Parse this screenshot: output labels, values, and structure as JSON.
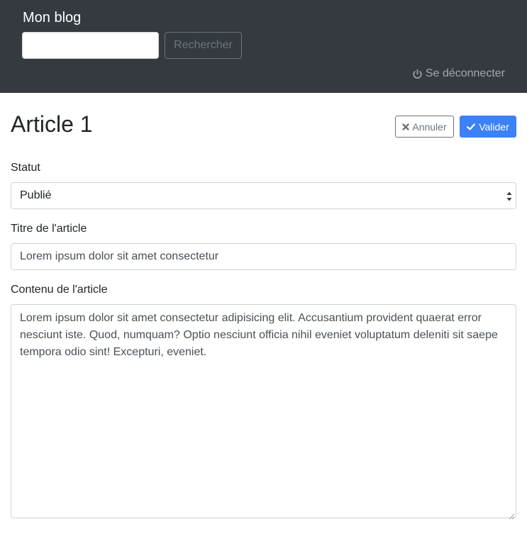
{
  "navbar": {
    "brand": "Mon blog",
    "search_value": "",
    "search_button": "Rechercher",
    "logout_label": "Se déconnecter",
    "logout_icon": "power-icon"
  },
  "header": {
    "title": "Article 1",
    "cancel_label": "Annuler",
    "cancel_icon": "times-icon",
    "validate_label": "Valider",
    "validate_icon": "check-icon"
  },
  "form": {
    "status_label": "Statut",
    "status_value": "Publié",
    "title_label": "Titre de l'article",
    "title_value": "Lorem ipsum dolor sit amet consectetur",
    "content_label": "Contenu de l'article",
    "content_value": "Lorem ipsum dolor sit amet consectetur adipisicing elit. Accusantium provident quaerat error nesciunt iste. Quod, numquam? Optio nesciunt officia nihil eveniet voluptatum deleniti sit saepe tempora odio sint! Excepturi, eveniet."
  },
  "colors": {
    "navbar_bg": "#343a40",
    "primary": "#3b82f6",
    "secondary": "#6c757d"
  }
}
